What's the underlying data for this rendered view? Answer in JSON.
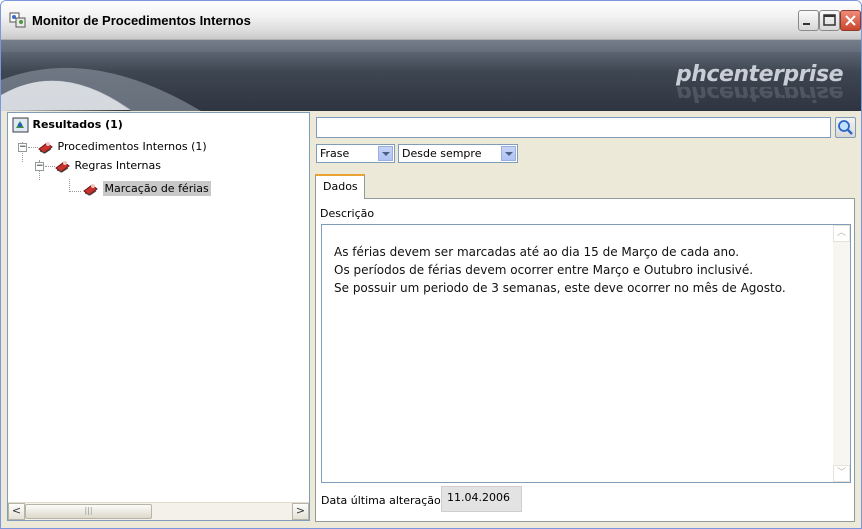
{
  "window": {
    "title": "Monitor de Procedimentos Internos"
  },
  "banner": {
    "brand": "phcenterprise"
  },
  "tree": {
    "root": "Resultados (1)",
    "level1": "Procedimentos Internos (1)",
    "level2": "Regras Internas",
    "level3": "Marcação de férias"
  },
  "search": {
    "value": ""
  },
  "filters": {
    "mode": "Frase",
    "period": "Desde sempre"
  },
  "tabs": {
    "dados": "Dados"
  },
  "details": {
    "description_label": "Descrição",
    "lines": [
      "As férias devem ser marcadas até ao dia 15 de Março de cada ano.",
      "Os períodos de férias devem ocorrer entre Março e Outubro inclusivé.",
      "Se possuir um periodo de 3 semanas, este deve ocorrer no mês de Agosto."
    ],
    "date_label": "Data última alteração",
    "date_value": "11.04.2006"
  }
}
